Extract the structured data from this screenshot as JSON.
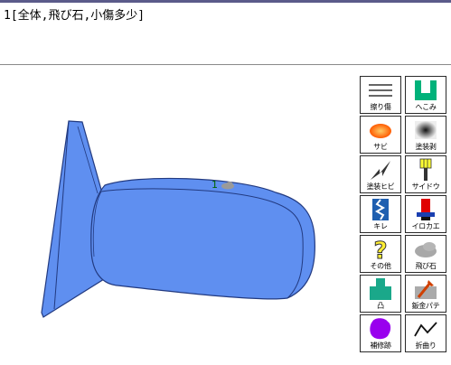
{
  "note": {
    "text": "1[全体,飛び石,小傷多少]"
  },
  "marker": {
    "number": "1",
    "icon": "stone-icon"
  },
  "palette": {
    "buttons": [
      {
        "label": "擦り傷",
        "icon": "scratch-lines-icon"
      },
      {
        "label": "へこみ",
        "icon": "dent-icon"
      },
      {
        "label": "サビ",
        "icon": "rust-icon"
      },
      {
        "label": "塗装剥",
        "icon": "paint-peel-icon"
      },
      {
        "label": "塗装ヒビ",
        "icon": "paint-crack-icon"
      },
      {
        "label": "サイドウ",
        "icon": "side-wall-icon"
      },
      {
        "label": "キレ",
        "icon": "cut-icon"
      },
      {
        "label": "イロカエ",
        "icon": "color-change-icon"
      },
      {
        "label": "その他",
        "icon": "question-icon"
      },
      {
        "label": "飛び石",
        "icon": "stone-icon"
      },
      {
        "label": "凸",
        "icon": "bump-icon"
      },
      {
        "label": "鈑金パテ",
        "icon": "putty-icon"
      },
      {
        "label": "補修跡",
        "icon": "repair-mark-icon"
      },
      {
        "label": "折曲り",
        "icon": "bend-icon"
      }
    ]
  },
  "colors": {
    "part_fill": "#5f8ff0",
    "part_stroke": "#223a80",
    "accent": "#009966"
  }
}
